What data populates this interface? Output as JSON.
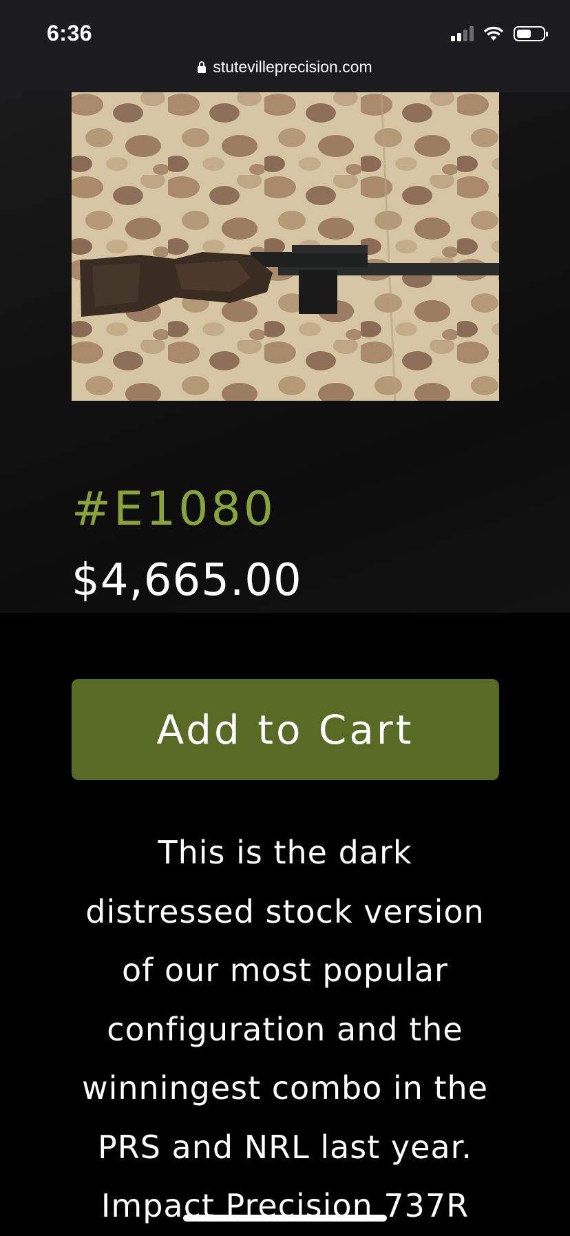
{
  "status_bar": {
    "time": "6:36"
  },
  "url_bar": {
    "domain": "stutevilleprecision.com"
  },
  "product": {
    "sku": "#E1080",
    "price": "$4,665.00",
    "add_to_cart_label": "Add to Cart",
    "description_lines": [
      "This is the dark",
      "distressed stock version",
      "of our most popular",
      "configuration and the",
      "winningest combo in the",
      "PRS and NRL last year.",
      "Impact Precision 737R"
    ]
  },
  "colors": {
    "sku_green": "#8aa33a",
    "button_green": "#586a24",
    "background": "#000000"
  }
}
